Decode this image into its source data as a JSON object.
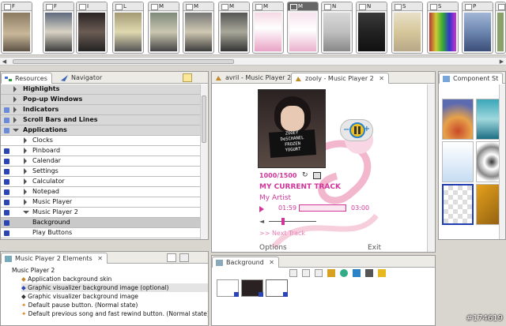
{
  "filmstrip": {
    "thumbs": [
      {
        "label": "F"
      },
      {
        "label": "F"
      },
      {
        "label": "I"
      },
      {
        "label": "L"
      },
      {
        "label": "M"
      },
      {
        "label": "M"
      },
      {
        "label": "M"
      },
      {
        "label": "M"
      },
      {
        "label": "M"
      },
      {
        "label": "N"
      },
      {
        "label": "N"
      },
      {
        "label": "S"
      },
      {
        "label": "S"
      },
      {
        "label": "P"
      },
      {
        "label": "S"
      }
    ]
  },
  "resources": {
    "tab_resources": "Resources",
    "tab_navigator": "Navigator",
    "rows": [
      "Highlights",
      "Pop-up Windows",
      "Indicators",
      "Scroll Bars and Lines",
      "Applications",
      "Clocks",
      "Pinboard",
      "Calendar",
      "Settings",
      "Calculator",
      "Notepad",
      "Music Player",
      "Music Player 2",
      "Background",
      "Play Buttons"
    ]
  },
  "editor": {
    "tab_1": "avril - Music Player 2",
    "tab_2": "zooly - Music Player 2",
    "counter": "1000/1500",
    "track": "MY CURRENT TRACK",
    "artist": "My Artist",
    "time_elapsed": "01:59",
    "time_total": "03:00",
    "next_track": ">> Next Track",
    "softkey_left": "Options",
    "softkey_right": "Exit",
    "sign_text": "ZOOEY\nDeSCHANEL\nFROZEN\nYOGURT",
    "progress_fraction": 0.0
  },
  "component_store": {
    "tab_label": "Component St"
  },
  "elements": {
    "tab_label": "Music Player 2 Elements",
    "items": [
      "Music Player 2",
      "Application background skin",
      "Graphic visualizer background image (optional)",
      "Graphic visualizer background image",
      "Default pause button. (Normal state)",
      "Default previous song and fast rewind button. (Normal state)"
    ]
  },
  "background_panel": {
    "tab_label": "Background"
  },
  "watermark": "#174619"
}
